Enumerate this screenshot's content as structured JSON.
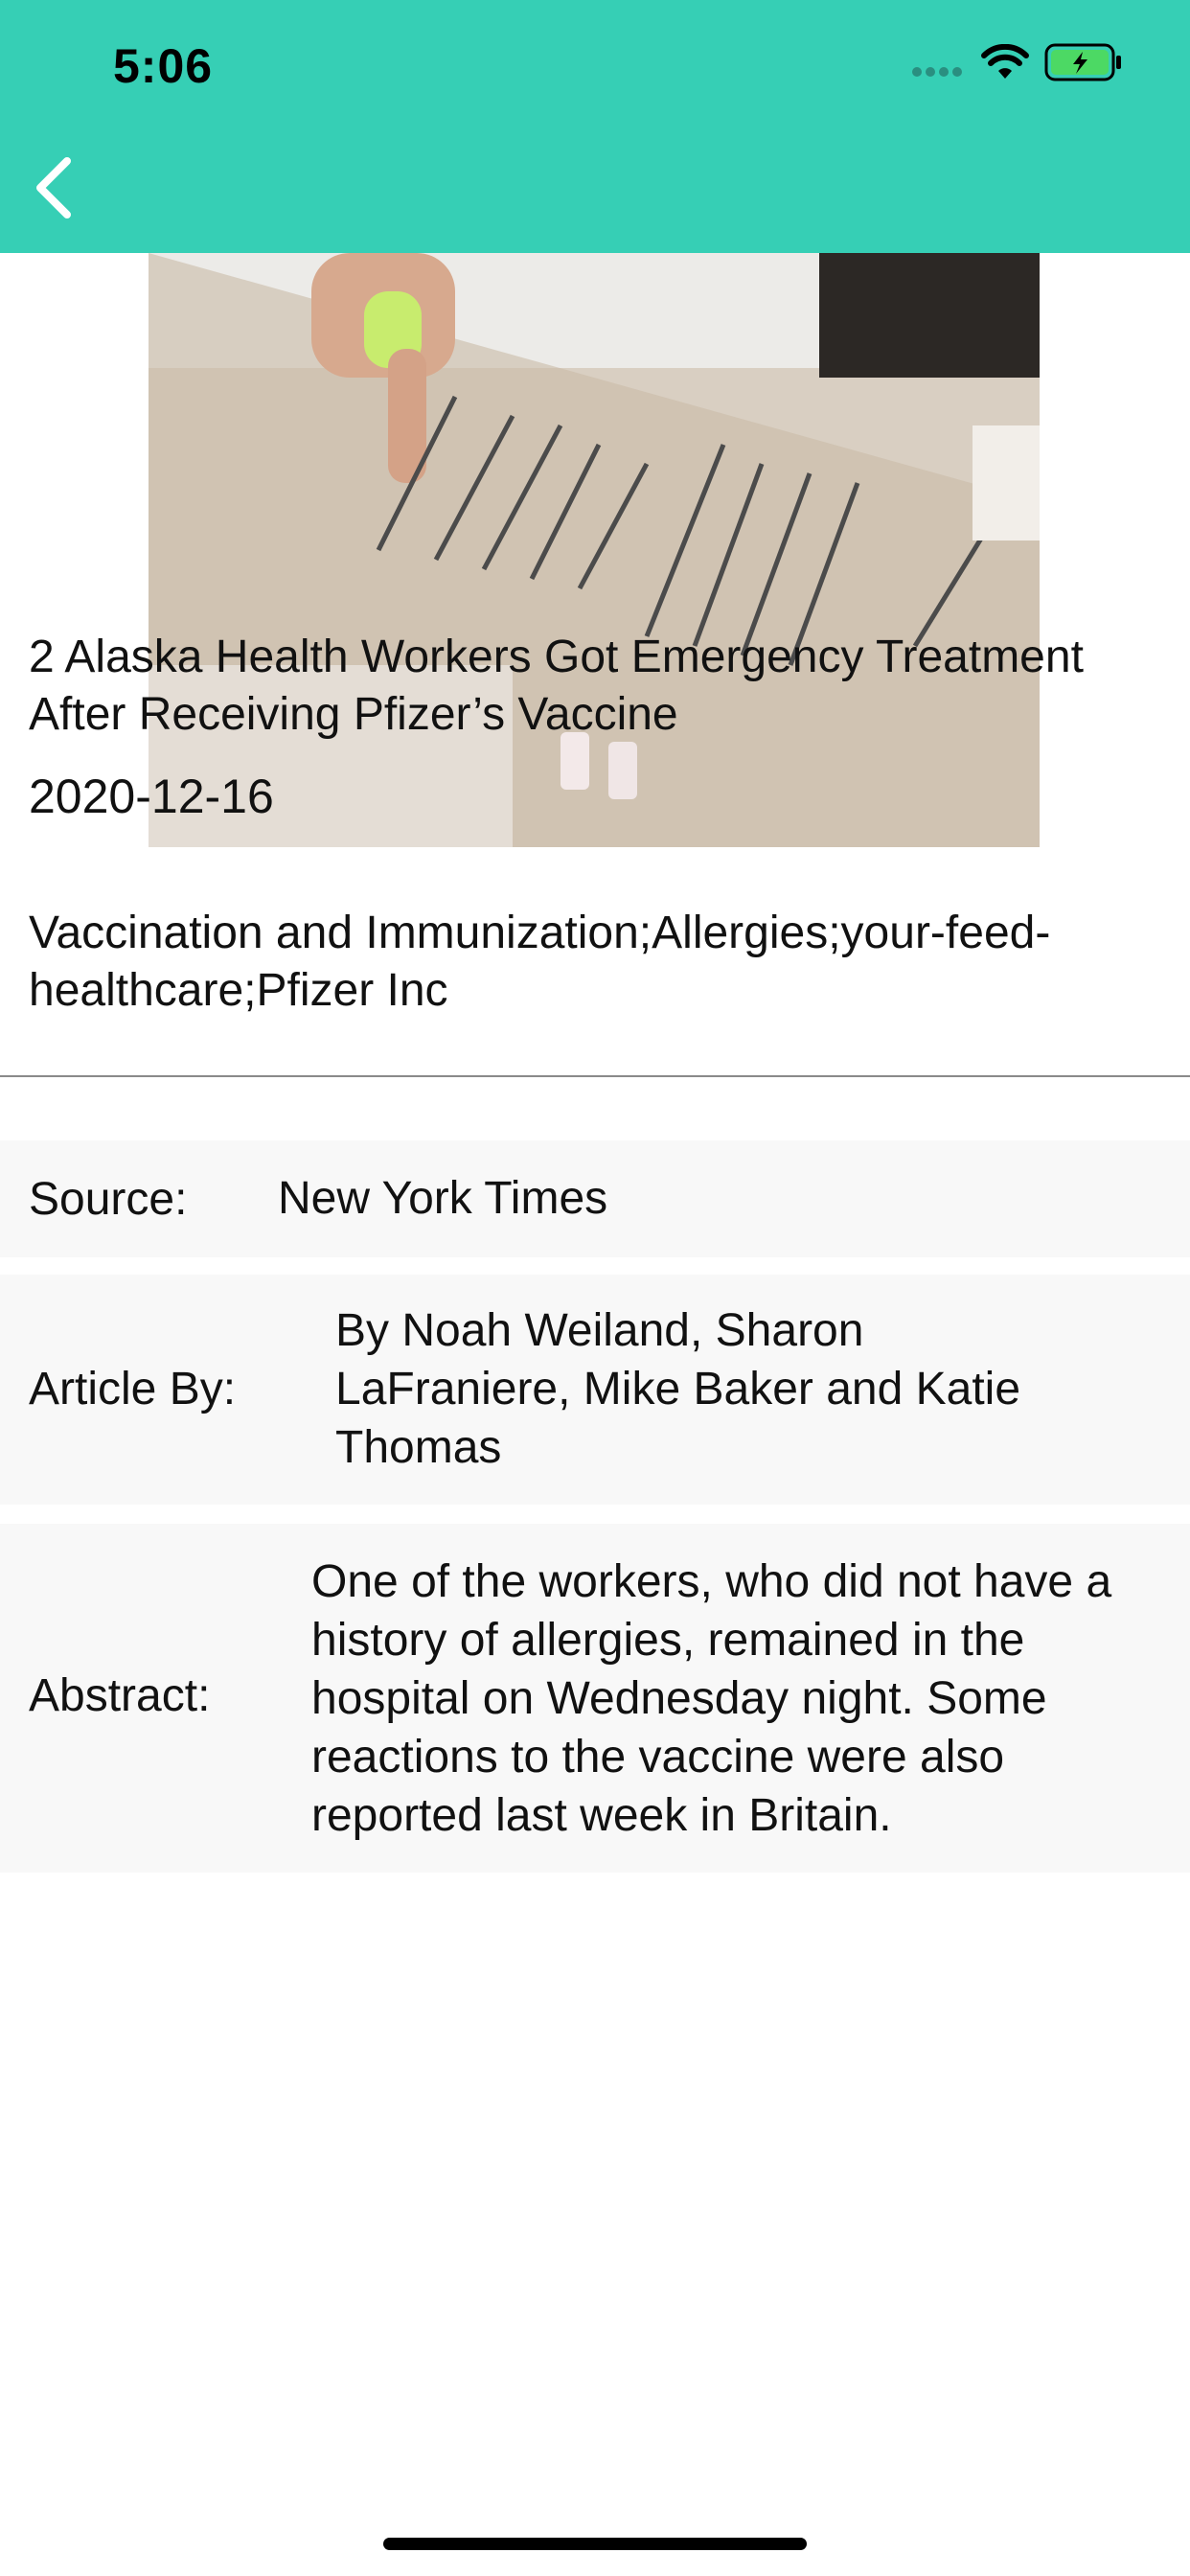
{
  "status_bar": {
    "time": "5:06"
  },
  "article": {
    "title": "2 Alaska Health Workers Got Emergency Treatment After Receiving Pfizer’s Vaccine",
    "date": "2020-12-16",
    "tags": "Vaccination and Immunization;Allergies;your-feed-healthcare;Pfizer Inc"
  },
  "details": {
    "source_label": "Source:",
    "source_value": "New York Times",
    "byline_label": "Article By:",
    "byline_value": "By Noah Weiland, Sharon LaFraniere, Mike Baker and Katie Thomas",
    "abstract_label": "Abstract:",
    "abstract_value": "One of the workers, who did not have a history of allergies, remained in the hospital on Wednesday night. Some reactions to the vaccine were also reported last week in Britain."
  },
  "colors": {
    "header": "#36CFB5",
    "row_background": "#f8f8f8",
    "battery_fill": "#4cd964"
  },
  "icons": [
    "back-arrow-icon",
    "wifi-icon",
    "battery-charging-icon",
    "cellular-signal-icon"
  ]
}
